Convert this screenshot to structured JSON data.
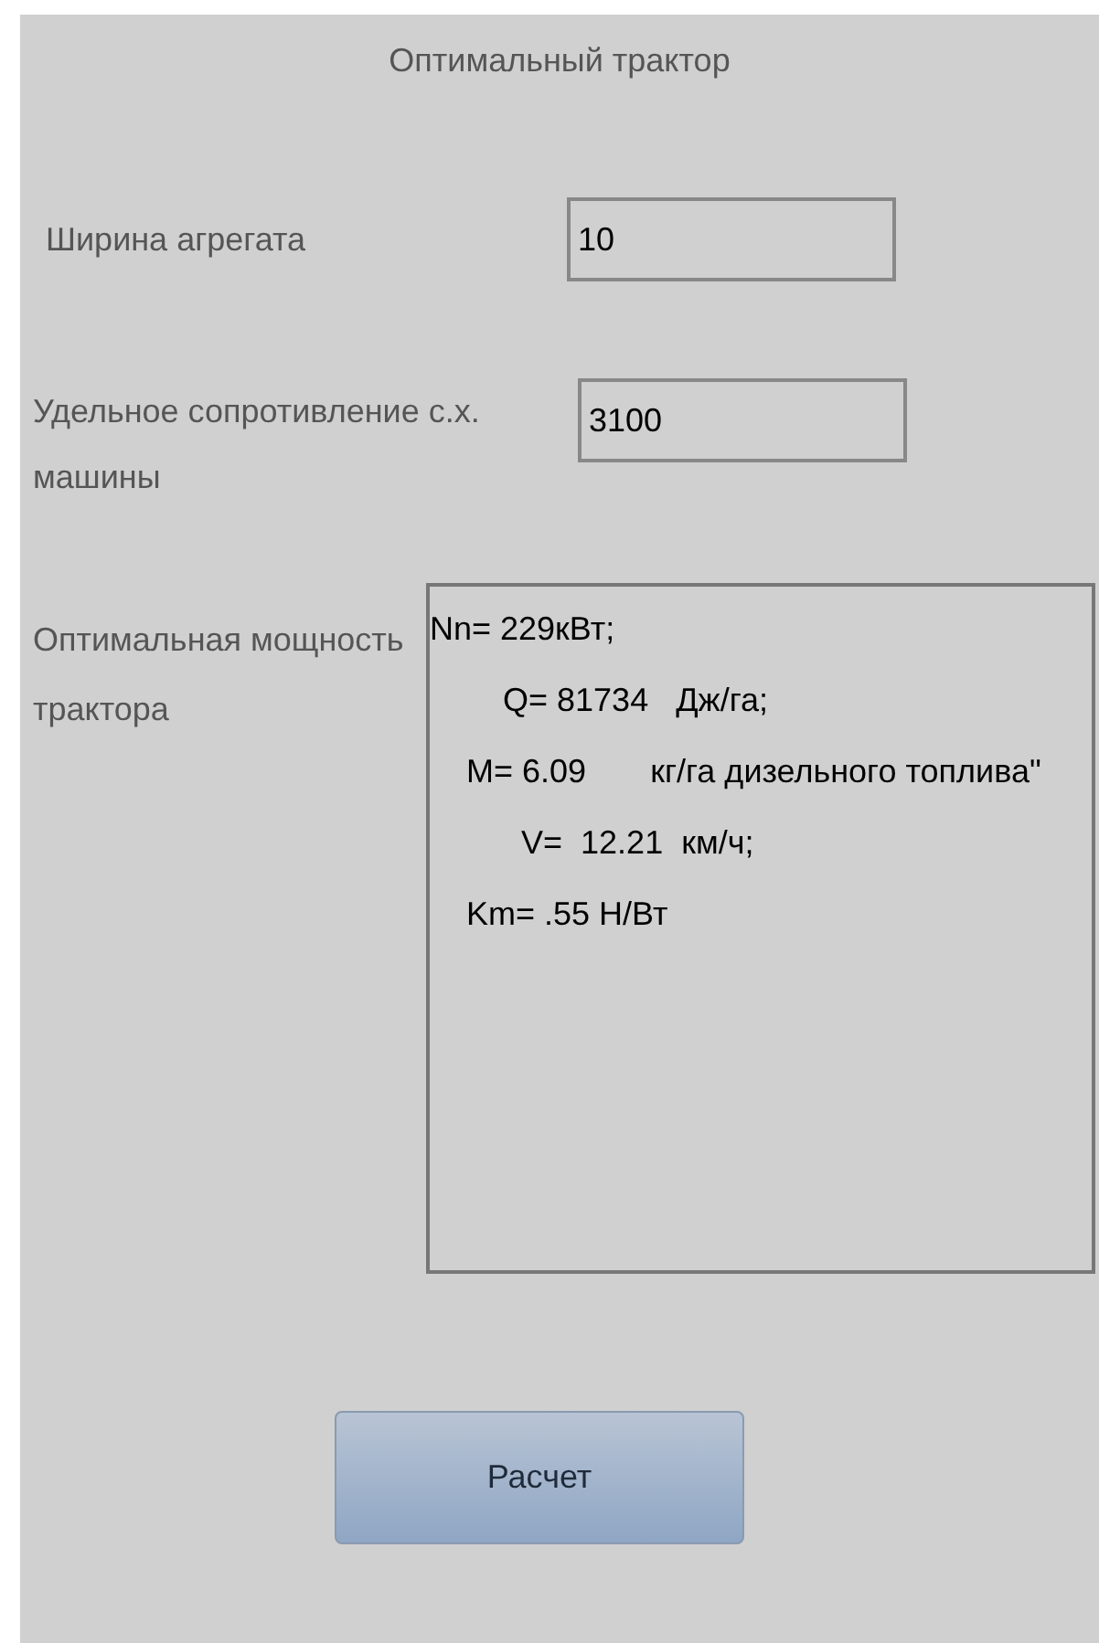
{
  "form": {
    "title": "Оптимальный трактор"
  },
  "fields": [
    {
      "label": "Ширина агрегата",
      "value": "10"
    },
    {
      "label": "Удельное сопротивление с.х. машины",
      "value": "3100"
    }
  ],
  "result": {
    "label": "Оптимальная мощность трактора",
    "value": "Nn= 229кВт;\n        Q= 81734   Дж/га;\n    M= 6.09       кг/га дизельного топлива\"\n          V=  12.21  км/ч;\n    Km= .55 Н/Вт"
  },
  "button": {
    "label": "Расчет"
  }
}
